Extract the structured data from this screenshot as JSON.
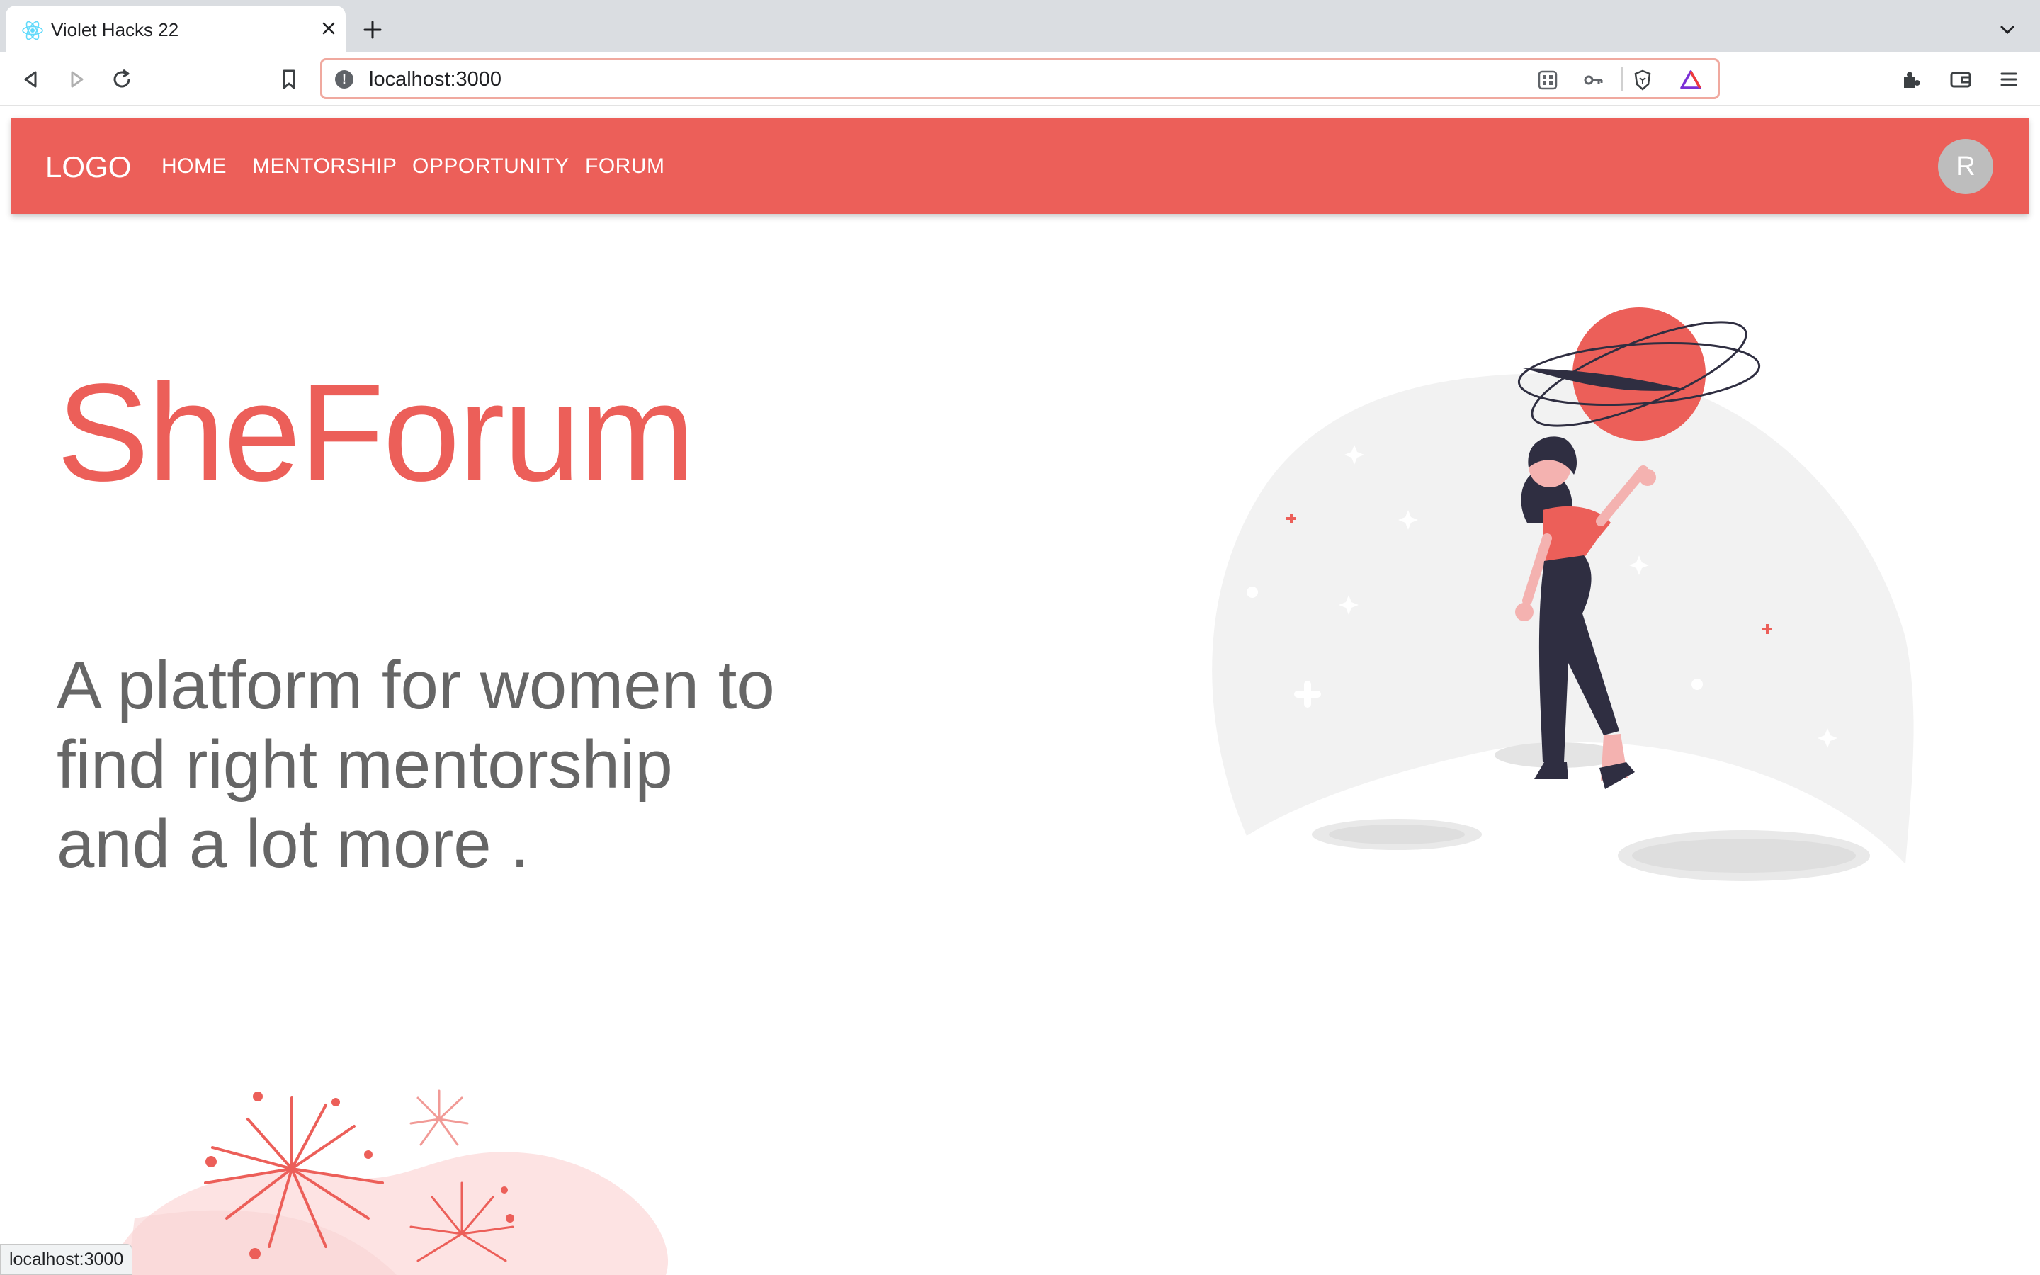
{
  "browser": {
    "tab_title": "Violet Hacks 22",
    "url": "localhost:3000",
    "status_url": "localhost:3000",
    "accent": "#f0a99f"
  },
  "navbar": {
    "logo": "LOGO",
    "links": [
      "HOME",
      "MENTORSHIP",
      "OPPORTUNITY",
      "FORUM"
    ],
    "avatar_initial": "R",
    "color": "#ec5f59"
  },
  "hero": {
    "title": "SheForum",
    "subtitle_lines": [
      "A platform for women to",
      "find right mentorship",
      "and a lot more ."
    ],
    "title_color": "#ec5f59",
    "subtitle_color": "#666666"
  },
  "icons": {
    "tab_favicon": "react-icon",
    "toolbar": [
      "back-icon",
      "forward-icon",
      "reload-icon",
      "bookmark-icon"
    ],
    "omnibox": [
      "site-info-icon",
      "qr-code-icon",
      "key-icon",
      "brave-shield-icon",
      "brave-rewards-icon"
    ],
    "right": [
      "extensions-icon",
      "wallet-icon",
      "menu-icon"
    ]
  }
}
